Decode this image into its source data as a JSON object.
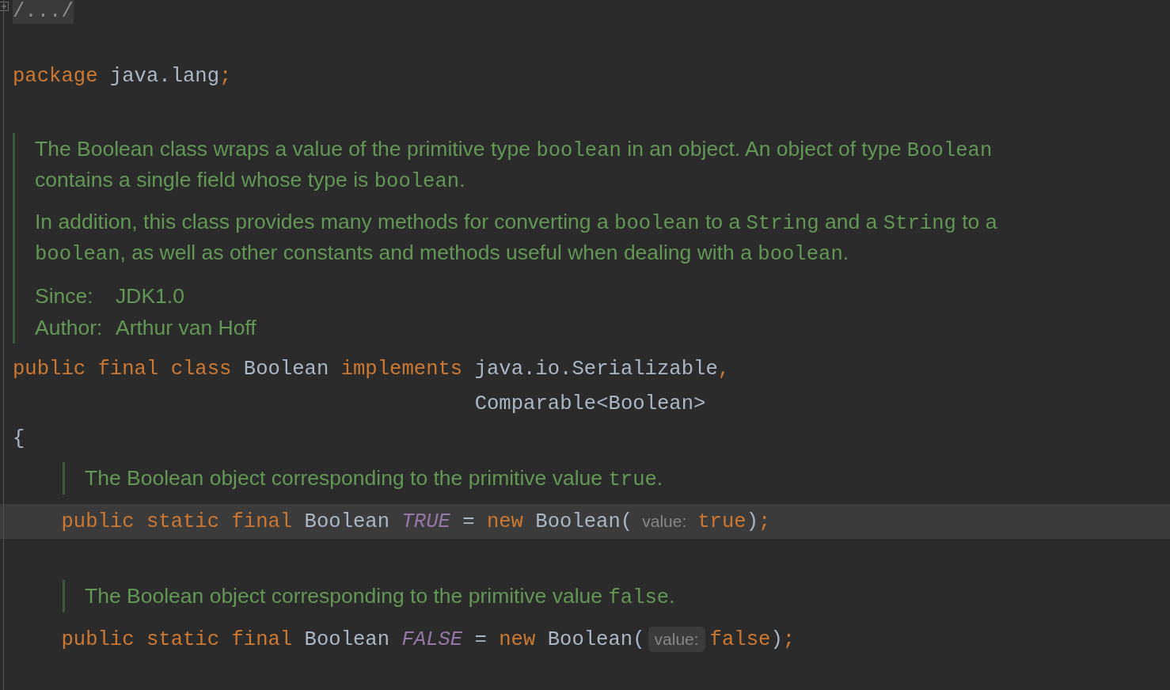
{
  "editor": {
    "folded_region": {
      "label": "/.../"
    },
    "blocks": [
      {
        "kind": "blank"
      },
      {
        "kind": "code",
        "indented": false,
        "current": false,
        "tokens": [
          {
            "kind": "keyword",
            "text": "package"
          },
          {
            "kind": "plain",
            "text": "java.lang"
          },
          {
            "kind": "keyword",
            "text": ";",
            "attach": true
          }
        ]
      },
      {
        "kind": "blank"
      },
      {
        "kind": "doc",
        "indented": false,
        "paragraphs": [
          {
            "kind": "text",
            "segments": [
              {
                "code": false,
                "text": "The Boolean class wraps a value of the primitive type "
              },
              {
                "code": true,
                "text": "boolean"
              },
              {
                "code": false,
                "text": " in an object. An object of type "
              },
              {
                "code": true,
                "text": "Boolean"
              },
              {
                "code": false,
                "text": " contains a single field whose type is "
              },
              {
                "code": true,
                "text": "boolean"
              },
              {
                "code": false,
                "text": "."
              }
            ]
          },
          {
            "kind": "text",
            "segments": [
              {
                "code": false,
                "text": "In addition, this class provides many methods for converting a "
              },
              {
                "code": true,
                "text": "boolean"
              },
              {
                "code": false,
                "text": " to a "
              },
              {
                "code": true,
                "text": "String"
              },
              {
                "code": false,
                "text": " and a "
              },
              {
                "code": true,
                "text": "String"
              },
              {
                "code": false,
                "text": " to a "
              },
              {
                "code": true,
                "text": "boolean"
              },
              {
                "code": false,
                "text": ", as well as other constants and methods useful when dealing with a "
              },
              {
                "code": true,
                "text": "boolean"
              },
              {
                "code": false,
                "text": "."
              }
            ]
          },
          {
            "kind": "tag",
            "label": "Since:",
            "value": "JDK1.0"
          },
          {
            "kind": "tag",
            "label": "Author:",
            "value": "Arthur van Hoff"
          }
        ]
      },
      {
        "kind": "code",
        "indented": false,
        "current": false,
        "tokens": [
          {
            "kind": "keyword",
            "text": "public"
          },
          {
            "kind": "keyword",
            "text": "final"
          },
          {
            "kind": "keyword",
            "text": "class"
          },
          {
            "kind": "plain",
            "text": "Boolean"
          },
          {
            "kind": "keyword",
            "text": "implements"
          },
          {
            "kind": "plain",
            "text": "java.io.Serializable"
          },
          {
            "kind": "keyword",
            "text": ",",
            "attach": true
          }
        ]
      },
      {
        "kind": "code",
        "indented": false,
        "current": false,
        "continuation": true,
        "tokens": [
          {
            "kind": "plain",
            "text": "Comparable<Boolean>"
          }
        ]
      },
      {
        "kind": "code",
        "indented": false,
        "current": false,
        "tokens": [
          {
            "kind": "plain",
            "text": "{"
          }
        ]
      },
      {
        "kind": "doc",
        "indented": true,
        "paragraphs": [
          {
            "kind": "text",
            "segments": [
              {
                "code": false,
                "text": "The Boolean object corresponding to the primitive value "
              },
              {
                "code": true,
                "text": "true"
              },
              {
                "code": false,
                "text": "."
              }
            ]
          }
        ]
      },
      {
        "kind": "code",
        "indented": true,
        "current": true,
        "tokens": [
          {
            "kind": "keyword",
            "text": "public"
          },
          {
            "kind": "keyword",
            "text": "static"
          },
          {
            "kind": "keyword",
            "text": "final"
          },
          {
            "kind": "plain",
            "text": "Boolean"
          },
          {
            "kind": "constant",
            "text": "TRUE"
          },
          {
            "kind": "plain",
            "text": "="
          },
          {
            "kind": "keyword",
            "text": "new"
          },
          {
            "kind": "plain",
            "text": "Boolean("
          },
          {
            "kind": "hint",
            "text": "value:",
            "attach": true
          },
          {
            "kind": "keyword",
            "text": "true",
            "attach": true
          },
          {
            "kind": "plain",
            "text": ")",
            "attach": true
          },
          {
            "kind": "keyword",
            "text": ";",
            "attach": true
          }
        ]
      },
      {
        "kind": "blank"
      },
      {
        "kind": "doc",
        "indented": true,
        "paragraphs": [
          {
            "kind": "text",
            "segments": [
              {
                "code": false,
                "text": "The Boolean object corresponding to the primitive value "
              },
              {
                "code": true,
                "text": "false"
              },
              {
                "code": false,
                "text": "."
              }
            ]
          }
        ]
      },
      {
        "kind": "code",
        "indented": true,
        "current": false,
        "tokens": [
          {
            "kind": "keyword",
            "text": "public"
          },
          {
            "kind": "keyword",
            "text": "static"
          },
          {
            "kind": "keyword",
            "text": "final"
          },
          {
            "kind": "plain",
            "text": "Boolean"
          },
          {
            "kind": "constant",
            "text": "FALSE"
          },
          {
            "kind": "plain",
            "text": "="
          },
          {
            "kind": "keyword",
            "text": "new"
          },
          {
            "kind": "plain",
            "text": "Boolean("
          },
          {
            "kind": "hint",
            "text": "value:",
            "attach": true
          },
          {
            "kind": "keyword",
            "text": "false",
            "attach": true
          },
          {
            "kind": "plain",
            "text": ")",
            "attach": true
          },
          {
            "kind": "keyword",
            "text": ";",
            "attach": true
          }
        ]
      }
    ]
  }
}
